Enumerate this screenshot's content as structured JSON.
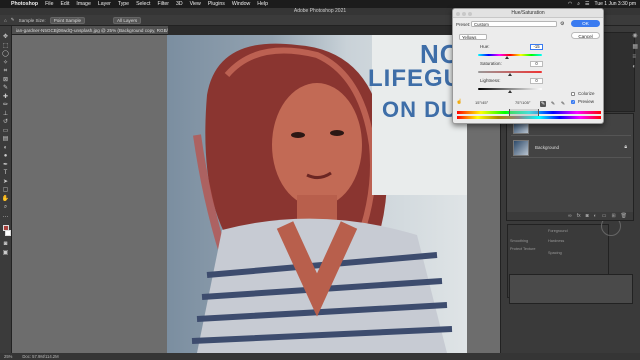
{
  "menubar": {
    "app": "Photoshop",
    "items": [
      "File",
      "Edit",
      "Image",
      "Layer",
      "Type",
      "Select",
      "Filter",
      "3D",
      "View",
      "Plugins",
      "Window",
      "Help"
    ],
    "clock": "Tue 1 Jun  3:30 pm"
  },
  "window": {
    "title": "Adobe Photoshop 2021"
  },
  "options": {
    "sample_size_label": "Sample Size:",
    "sample_size_value": "Point Sample",
    "sample_value": "All Layers"
  },
  "document": {
    "tab": "ian-gardner-N5GCBj08wdQ-unsplash.jpg @ 25% (Background copy, RGB/8) *"
  },
  "photo": {
    "sign_lines": [
      "NO",
      "LIFEGUA",
      "ON DUTY"
    ]
  },
  "status": {
    "zoom": "25%",
    "doc": "Doc: 57.9M/114.2M"
  },
  "layers": {
    "items": [
      "Background"
    ]
  },
  "properties": {
    "labels": [
      "Foreground",
      "Hardness",
      "Spacing",
      "Smoothing",
      "Protect Texture"
    ]
  },
  "dialog": {
    "title": "Hue/Saturation",
    "preset_label": "Preset:",
    "preset_value": "Custom",
    "ok_label": "OK",
    "cancel_label": "Cancel",
    "channel": "Yellows",
    "hue_label": "Hue:",
    "hue_value": "-15",
    "saturation_label": "Saturation:",
    "saturation_value": "0",
    "lightness_label": "Lightness:",
    "lightness_value": "0",
    "colorize_label": "Colorize",
    "preview_label": "Preview",
    "range_left": "15°/45°",
    "range_right": "75°\\105°",
    "colorize_checked": false,
    "preview_checked": true,
    "hue_fraction": 0.46,
    "saturation_fraction": 0.5,
    "lightness_fraction": 0.5
  },
  "colors": {
    "accent": "#3a7bf0",
    "sign_text": "#3e6ea8",
    "foreground_swatch": "#a8403b"
  }
}
